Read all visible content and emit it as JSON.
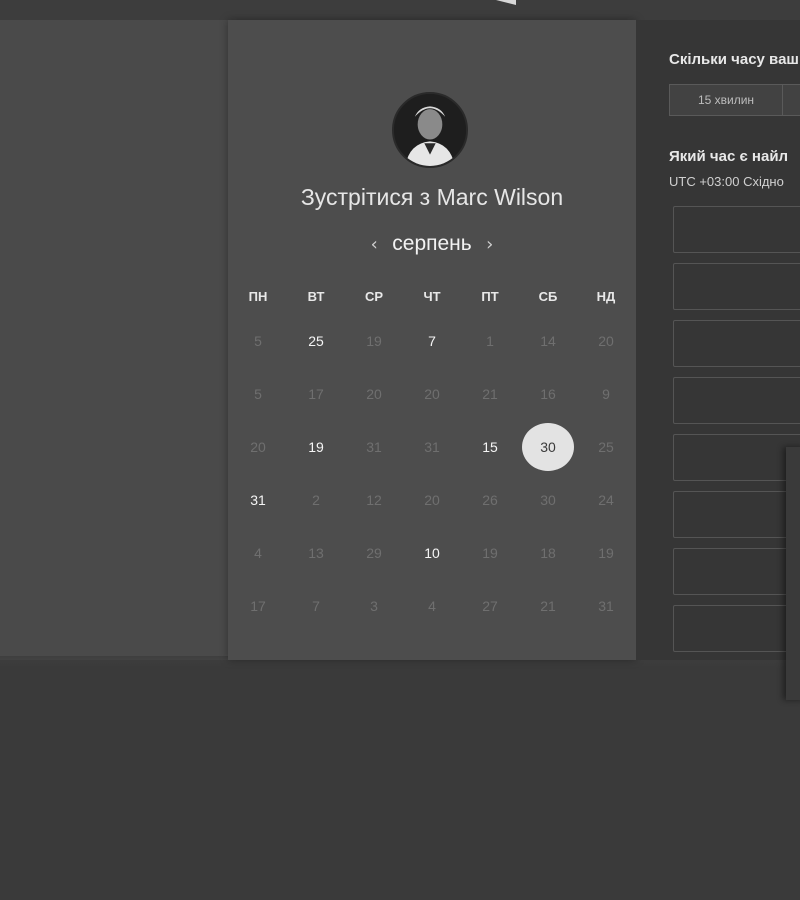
{
  "scheduler": {
    "title": "Зустрітися з Marc Wilson",
    "month": "серпень",
    "prev_icon": "chevron-left-icon",
    "next_icon": "chevron-right-icon",
    "weekdays": [
      "ПН",
      "ВТ",
      "СР",
      "ЧТ",
      "ПТ",
      "СБ",
      "НД"
    ],
    "weeks": [
      [
        {
          "d": "5",
          "a": false
        },
        {
          "d": "25",
          "a": true
        },
        {
          "d": "19",
          "a": false
        },
        {
          "d": "7",
          "a": true
        },
        {
          "d": "1",
          "a": false
        },
        {
          "d": "14",
          "a": false
        },
        {
          "d": "20",
          "a": false
        }
      ],
      [
        {
          "d": "5",
          "a": false
        },
        {
          "d": "17",
          "a": false
        },
        {
          "d": "20",
          "a": false
        },
        {
          "d": "20",
          "a": false
        },
        {
          "d": "21",
          "a": false
        },
        {
          "d": "16",
          "a": false
        },
        {
          "d": "9",
          "a": false
        }
      ],
      [
        {
          "d": "20",
          "a": false
        },
        {
          "d": "19",
          "a": true
        },
        {
          "d": "31",
          "a": false
        },
        {
          "d": "31",
          "a": false
        },
        {
          "d": "15",
          "a": true
        },
        {
          "d": "30",
          "a": true,
          "selected": true
        },
        {
          "d": "25",
          "a": false
        }
      ],
      [
        {
          "d": "31",
          "a": true
        },
        {
          "d": "2",
          "a": false
        },
        {
          "d": "12",
          "a": false
        },
        {
          "d": "20",
          "a": false
        },
        {
          "d": "26",
          "a": false
        },
        {
          "d": "30",
          "a": false
        },
        {
          "d": "24",
          "a": false
        }
      ],
      [
        {
          "d": "4",
          "a": false
        },
        {
          "d": "13",
          "a": false
        },
        {
          "d": "29",
          "a": false
        },
        {
          "d": "10",
          "a": true
        },
        {
          "d": "19",
          "a": false
        },
        {
          "d": "18",
          "a": false
        },
        {
          "d": "19",
          "a": false
        }
      ],
      [
        {
          "d": "17",
          "a": false
        },
        {
          "d": "7",
          "a": false
        },
        {
          "d": "3",
          "a": false
        },
        {
          "d": "4",
          "a": false
        },
        {
          "d": "27",
          "a": false
        },
        {
          "d": "21",
          "a": false
        },
        {
          "d": "31",
          "a": false
        }
      ]
    ]
  },
  "booking": {
    "duration_question": "Скільки часу ваш",
    "duration_options": [
      "15 хвилин",
      ""
    ],
    "time_question": "Який час є найл",
    "timezone": "UTC +03:00 Східно",
    "slots_count": 8
  }
}
